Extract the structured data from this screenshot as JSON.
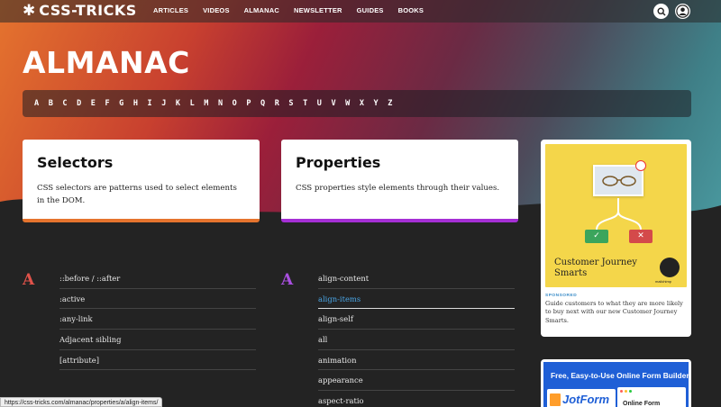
{
  "brand": {
    "logo_star": "✱",
    "logo_text": "CSS-TRICKS"
  },
  "nav": {
    "links": [
      "ARTICLES",
      "VIDEOS",
      "ALMANAC",
      "NEWSLETTER",
      "GUIDES",
      "BOOKS"
    ],
    "search_icon": "search-icon",
    "user_icon": "user-icon"
  },
  "page_title": "ALMANAC",
  "alphabet": [
    "A",
    "B",
    "C",
    "D",
    "E",
    "F",
    "G",
    "H",
    "I",
    "J",
    "K",
    "L",
    "M",
    "N",
    "O",
    "P",
    "Q",
    "R",
    "S",
    "T",
    "U",
    "V",
    "W",
    "X",
    "Y",
    "Z"
  ],
  "cards": {
    "selectors": {
      "title": "Selectors",
      "description": "CSS selectors are patterns used to select elements in the DOM."
    },
    "properties": {
      "title": "Properties",
      "description": "CSS properties style elements through their values."
    }
  },
  "colors": {
    "selectors_accent": "#e5742e",
    "properties_accent": "#a52fd5",
    "letter_a_left": "#e0524a",
    "letter_a_right": "#a94fe0",
    "link_active": "#4aa6e6"
  },
  "ad": {
    "heading": "Customer Journey Smarts",
    "brand_small": "mailchimp",
    "check": "✓",
    "cross": "✕",
    "sponsored_label": "SPONSORED",
    "text": "Guide customers to what they are more likely to buy next with our new Customer Journey Smarts."
  },
  "ad2": {
    "title": "Free, Easy-to-Use Online Form Builder",
    "logo": "JotForm",
    "window_text": "Online Form"
  },
  "lists": {
    "selectors": {
      "letter": "A",
      "items": [
        "::before / ::after",
        ":active",
        ":any-link",
        "Adjacent sibling",
        "[attribute]"
      ]
    },
    "properties": {
      "letter": "A",
      "items": [
        "align-content",
        "align-items",
        "align-self",
        "all",
        "animation",
        "appearance",
        "aspect-ratio"
      ],
      "active_index": 1
    }
  },
  "status_url": "https://css-tricks.com/almanac/properties/a/align-items/"
}
